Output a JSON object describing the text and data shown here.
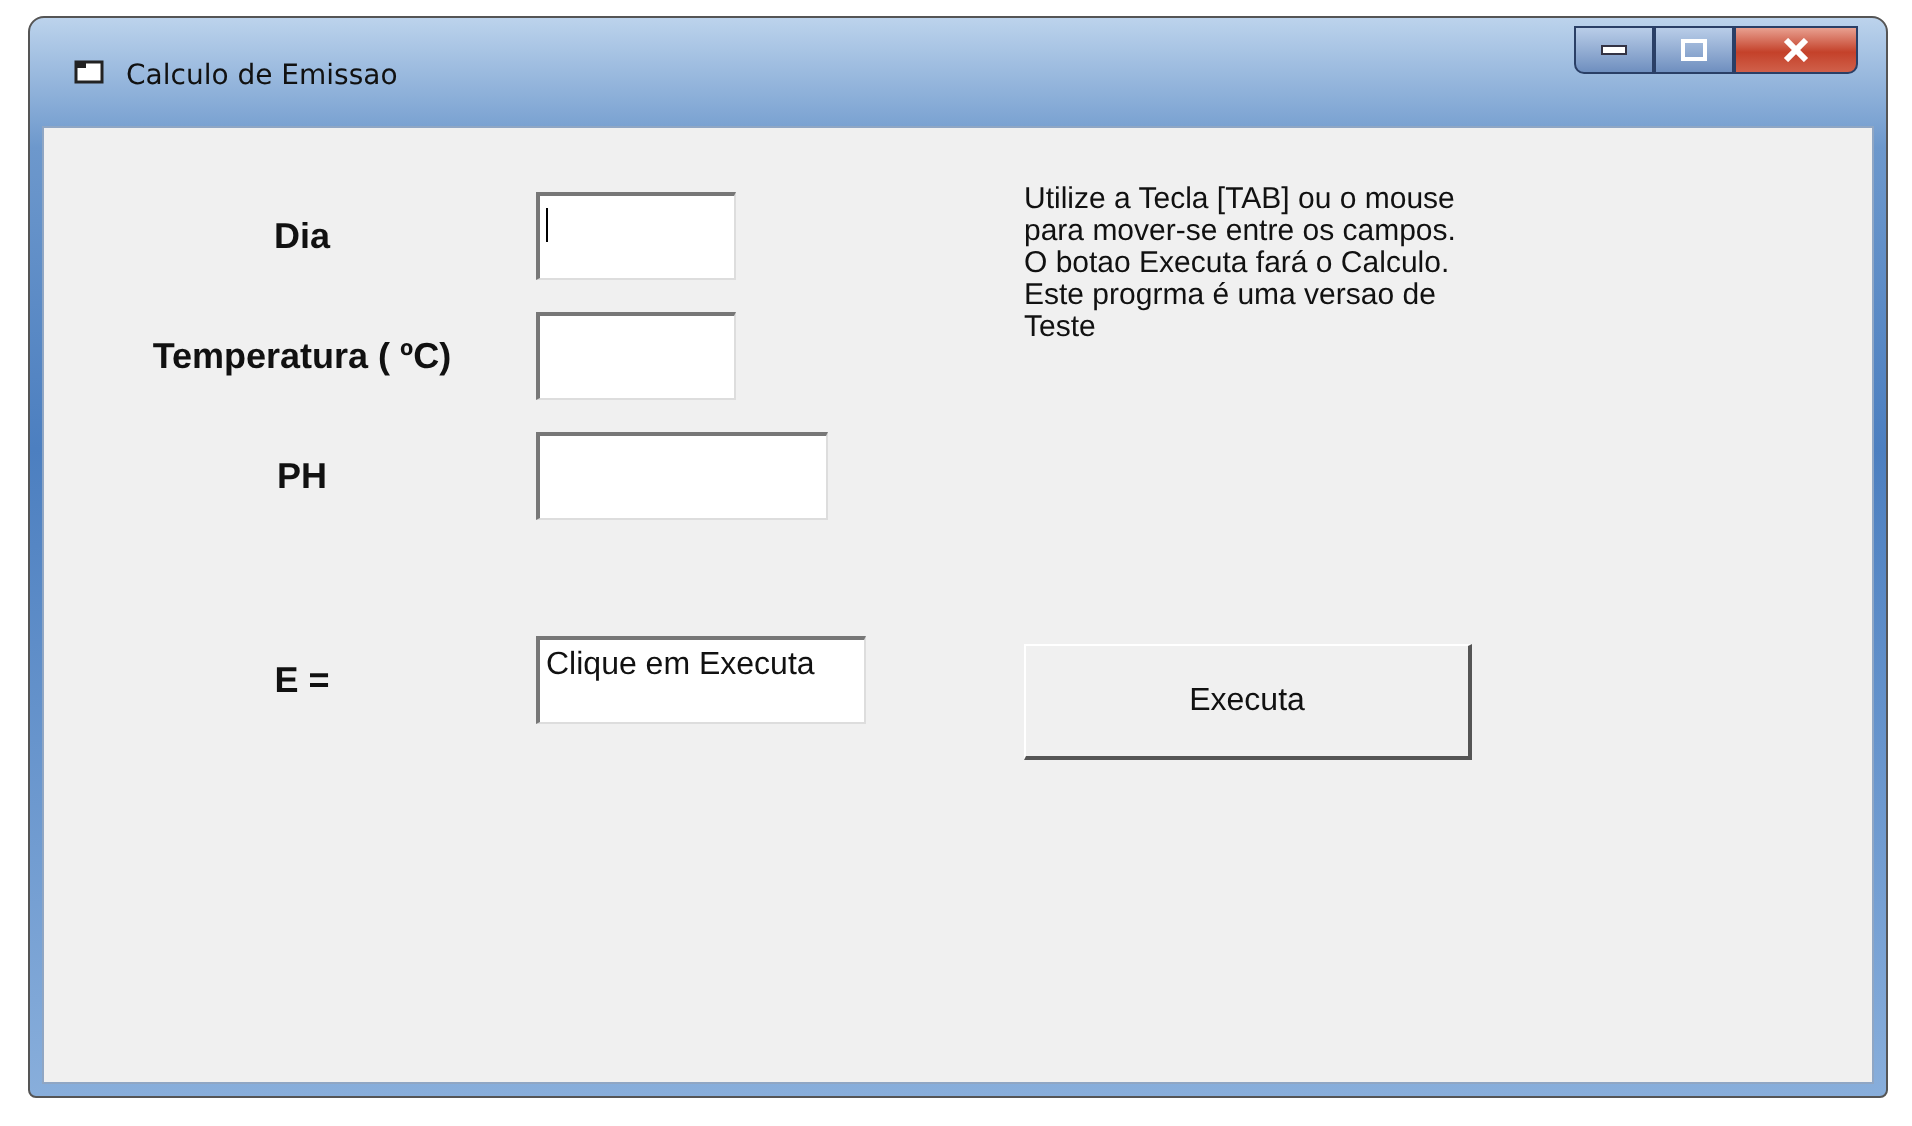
{
  "window": {
    "title": "Calculo de Emissao"
  },
  "fields": [
    {
      "label": "Dia",
      "focused": true,
      "kind": "short"
    },
    {
      "label": "Temperatura ( ºC)",
      "focused": false,
      "kind": "short"
    },
    {
      "label": "PH",
      "focused": false,
      "kind": "medium"
    }
  ],
  "result": {
    "label": "E =",
    "value": "Clique em Executa"
  },
  "help_text": "Utilize a Tecla [TAB] ou o mouse para mover-se entre os campos. O botao Executa fará o Calculo.  Este progrma é uma versao de Teste",
  "button": "Executa"
}
